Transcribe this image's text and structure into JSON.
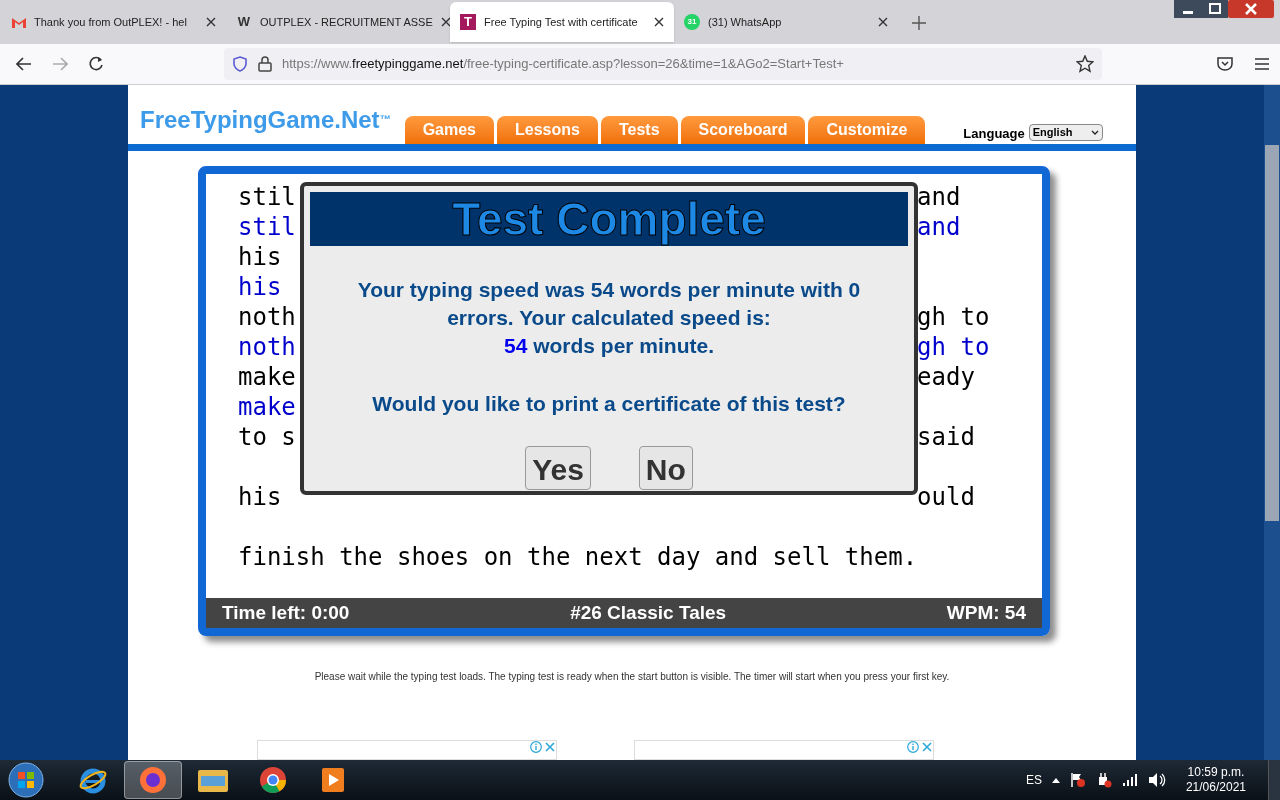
{
  "browser": {
    "tabs": [
      {
        "title": "Thank you from OutPLEX! - hel",
        "kind": "gmail",
        "selected": false
      },
      {
        "title": "OUTPLEX - RECRUITMENT ASSE",
        "kind": "letter",
        "letter": "W",
        "selected": false
      },
      {
        "title": "Free Typing Test with certificate",
        "kind": "letter",
        "letter": "T",
        "selected": true
      },
      {
        "title": "(31) WhatsApp",
        "kind": "whatsapp",
        "badge": "31",
        "selected": false
      }
    ],
    "url": {
      "prefix": "https://www.",
      "host": "freetypinggame.net",
      "path": "/free-typing-certificate.asp?lesson=26&time=1&AGo2=Start+Test+"
    }
  },
  "site": {
    "logo": "FreeTypingGame.Net",
    "trademark": "™",
    "nav": [
      {
        "label": "Games"
      },
      {
        "label": "Lessons"
      },
      {
        "label": "Tests"
      },
      {
        "label": "Scoreboard"
      },
      {
        "label": "Customize"
      }
    ],
    "language_label": "Language",
    "language": "English"
  },
  "typing_lines": [
    {
      "kind": "source",
      "left": "stil",
      "right": "and"
    },
    {
      "kind": "typed",
      "left": "stil",
      "right": "and"
    },
    {
      "kind": "source",
      "left": "his"
    },
    {
      "kind": "typed",
      "left": "his"
    },
    {
      "kind": "source",
      "left": "noth",
      "right": "gh to"
    },
    {
      "kind": "typed",
      "left": "noth",
      "right": "gh to"
    },
    {
      "kind": "source",
      "left": "make",
      "right": "eady"
    },
    {
      "kind": "typed",
      "left": "make"
    },
    {
      "kind": "source",
      "left": "to s",
      "right": "said"
    },
    {
      "kind": "blank"
    },
    {
      "kind": "source",
      "left": "his",
      "right": "ould"
    },
    {
      "kind": "blank"
    },
    {
      "kind": "source",
      "left": "finish the shoes on the next day and sell them."
    }
  ],
  "modal": {
    "title": "Test Complete",
    "message": "Your typing speed was 54 words per minute with 0 errors. Your calculated speed is:",
    "speed": "54",
    "speed_unit": "words per minute.",
    "question": "Would you like to print a certificate of this test?",
    "buttons": [
      "Yes",
      "No"
    ]
  },
  "status_bar": {
    "time_left": "Time left: 0:00",
    "test_name": "#26 Classic Tales",
    "wpm": "WPM: 54"
  },
  "footer_note": "Please wait while the typing test loads. The typing test is ready when the start button is visible. The timer will start when you press your first key.",
  "taskbar": {
    "apps": [
      {
        "kind": "ie",
        "selected": false
      },
      {
        "kind": "firefox",
        "selected": true
      },
      {
        "kind": "explorer",
        "selected": false
      },
      {
        "kind": "chrome",
        "selected": false
      },
      {
        "kind": "media",
        "selected": false
      }
    ],
    "language": "ES",
    "time": "10:59 p.m.",
    "date": "21/06/2021"
  }
}
